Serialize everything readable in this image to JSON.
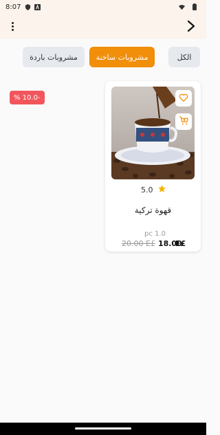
{
  "status_bar": {
    "time": "8:07",
    "icons": [
      "shield-icon",
      "a-badge-icon",
      "wifi-icon",
      "battery-icon"
    ]
  },
  "app_bar": {
    "menu_icon": "more-vert-icon",
    "back_icon": "chevron-right-icon"
  },
  "categories": [
    {
      "label": "الكل",
      "active": false
    },
    {
      "label": "مشروبات ساخنة",
      "active": true
    },
    {
      "label": "مشروبات باردة",
      "active": false
    }
  ],
  "product": {
    "discount": "% 10.0-",
    "rating": "5.0",
    "name": "قهوة تركية",
    "unit": "pc 1.0",
    "old_price": "20.00 E£",
    "new_price": "18.00",
    "currency": "E£"
  },
  "colors": {
    "accent": "#f18e0a",
    "discount": "#f1565c",
    "star": "#f5b400",
    "header_bg": "#fbf3ec"
  }
}
